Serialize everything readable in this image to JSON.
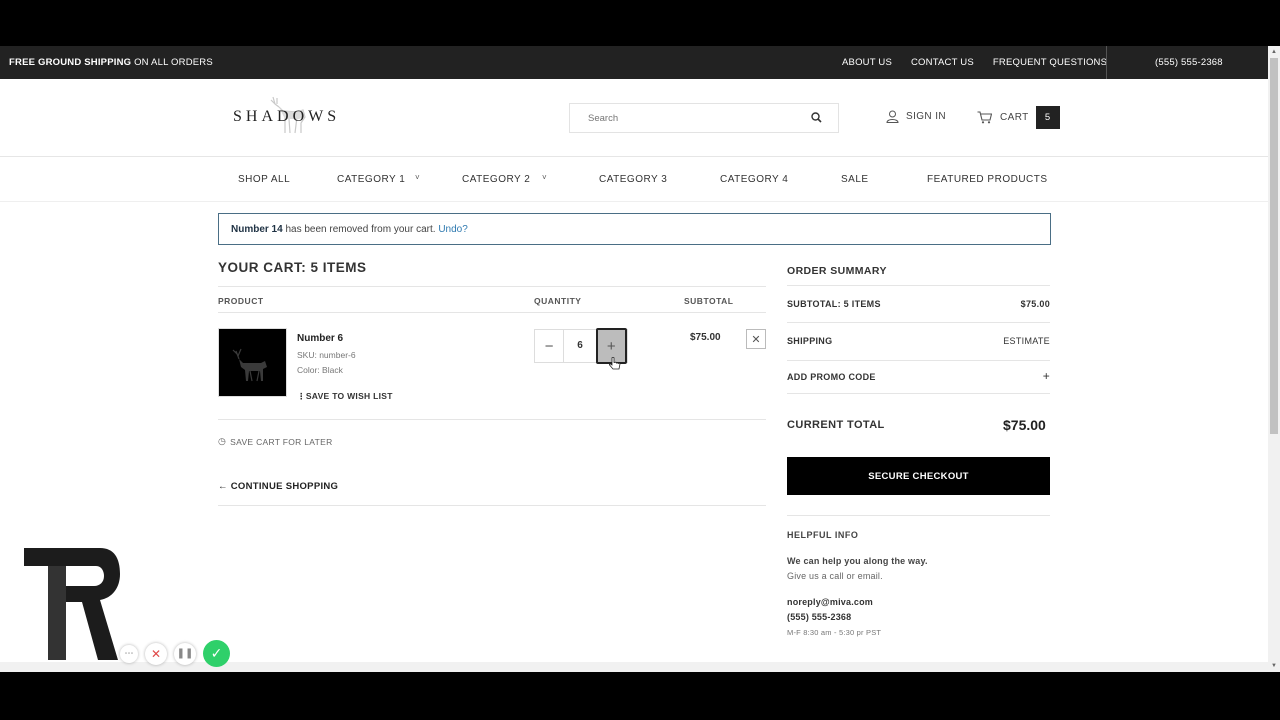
{
  "topbar": {
    "promo_bold": "FREE GROUND SHIPPING",
    "promo_rest": " ON ALL ORDERS",
    "links": [
      "ABOUT US",
      "CONTACT US",
      "FREQUENT QUESTIONS"
    ],
    "phone": "(555) 555-2368"
  },
  "header": {
    "logo_text": "SHADOWS",
    "search_placeholder": "Search",
    "sign_in": "SIGN IN",
    "cart_label": "CART",
    "cart_count": "5"
  },
  "nav": {
    "items": [
      "SHOP ALL",
      "CATEGORY 1",
      "CATEGORY 2",
      "CATEGORY 3",
      "CATEGORY 4",
      "SALE",
      "FEATURED PRODUCTS"
    ]
  },
  "notice": {
    "product": "Number 14",
    "message": " has been removed from your cart. ",
    "undo": "Undo?"
  },
  "cart": {
    "title": "YOUR CART: 5 ITEMS",
    "columns": [
      "PRODUCT",
      "QUANTITY",
      "SUBTOTAL"
    ],
    "item": {
      "name": "Number 6",
      "sku": "SKU: number-6",
      "color": "Color: Black",
      "wish": "SAVE TO WISH LIST",
      "quantity": "6",
      "subtotal": "$75.00"
    },
    "save_later": "SAVE CART FOR LATER",
    "continue": "CONTINUE SHOPPING"
  },
  "summary": {
    "title": "ORDER SUMMARY",
    "subtotal_label": "SUBTOTAL: 5 ITEMS",
    "subtotal_value": "$75.00",
    "shipping_label": "SHIPPING",
    "shipping_value": "ESTIMATE",
    "promo_label": "ADD PROMO CODE",
    "promo_toggle": "+",
    "total_label": "CURRENT TOTAL",
    "total_value": "$75.00",
    "checkout": "SECURE CHECKOUT"
  },
  "help": {
    "title": "HELPFUL INFO",
    "line1": "We can help you along the way.",
    "line2": "Give us a call or email.",
    "email": "noreply@miva.com",
    "phone": "(555) 555-2368",
    "hours": "M-F 8:30 am - 5:30 pr PST"
  },
  "colors": {
    "topbar_bg": "#222222",
    "notice_border": "#4a6e85",
    "link": "#2f7ab0",
    "checkout_bg": "#000000",
    "confirm_green": "#2fd06a"
  }
}
